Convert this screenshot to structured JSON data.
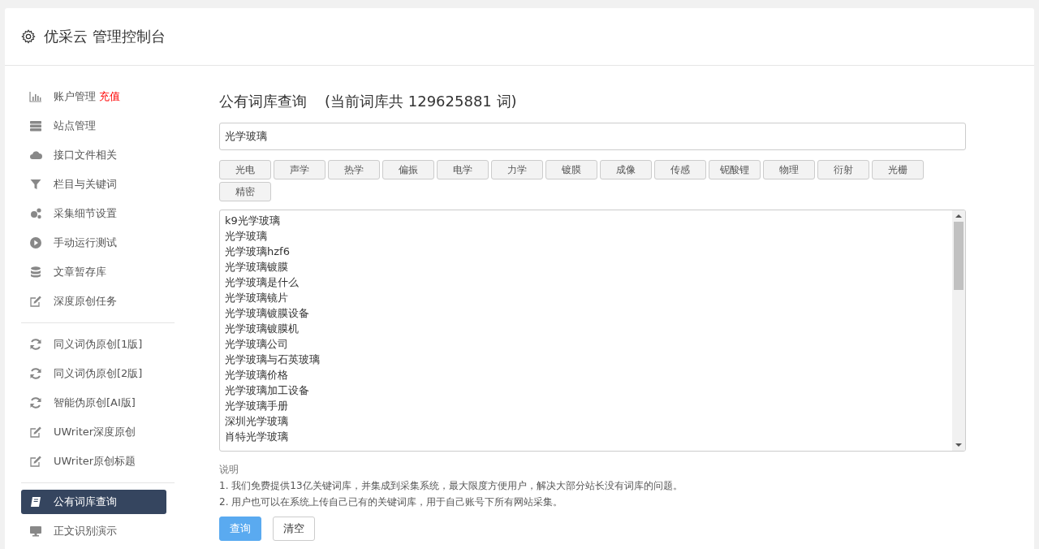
{
  "header": {
    "title": "优采云 管理控制台"
  },
  "sidebar": {
    "groups": [
      [
        {
          "label": "账户管理",
          "badge": "充值",
          "selected": false
        },
        {
          "label": "站点管理",
          "selected": false
        },
        {
          "label": "接口文件相关",
          "selected": false
        },
        {
          "label": "栏目与关键词",
          "selected": false
        },
        {
          "label": "采集细节设置",
          "selected": false
        },
        {
          "label": "手动运行测试",
          "selected": false
        },
        {
          "label": "文章暂存库",
          "selected": false
        },
        {
          "label": "深度原创任务",
          "selected": false
        }
      ],
      [
        {
          "label": "同义词伪原创[1版]",
          "selected": false
        },
        {
          "label": "同义词伪原创[2版]",
          "selected": false
        },
        {
          "label": "智能伪原创[AI版]",
          "selected": false
        },
        {
          "label": "UWriter深度原创",
          "selected": false
        },
        {
          "label": "UWriter原创标题",
          "selected": false
        }
      ],
      [
        {
          "label": "公有词库查询",
          "selected": true
        },
        {
          "label": "正文识别演示",
          "selected": false
        }
      ]
    ]
  },
  "main": {
    "title": "公有词库查询",
    "subtitle": "(当前词库共 129625881 词)",
    "search": {
      "value": "光学玻璃"
    },
    "tags": [
      "光电",
      "声学",
      "热学",
      "偏振",
      "电学",
      "力学",
      "镀膜",
      "成像",
      "传感",
      "铌酸锂",
      "物理",
      "衍射",
      "光栅",
      "精密"
    ],
    "results": [
      "k9光学玻璃",
      "光学玻璃",
      "光学玻璃hzf6",
      "光学玻璃镀膜",
      "光学玻璃是什么",
      "光学玻璃镜片",
      "光学玻璃镀膜设备",
      "光学玻璃镀膜机",
      "光学玻璃公司",
      "光学玻璃与石英玻璃",
      "光学玻璃价格",
      "光学玻璃加工设备",
      "光学玻璃手册",
      "深圳光学玻璃",
      "肖特光学玻璃"
    ],
    "notes_title": "说明",
    "notes": [
      "1. 我们免费提供13亿关键词库，并集成到采集系统，最大限度方便用户，解决大部分站长没有词库的问题。",
      "2. 用户也可以在系统上传自己已有的关键词库，用于自己账号下所有网站采集。"
    ],
    "buttons": [
      {
        "label": "查询",
        "kind": "primary"
      },
      {
        "label": "清空",
        "kind": "default"
      }
    ]
  }
}
